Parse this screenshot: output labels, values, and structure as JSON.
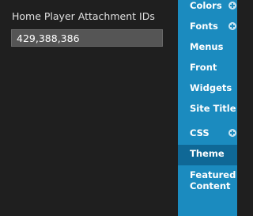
{
  "field": {
    "label": "Home Player Attachment IDs",
    "value": "429,388,386"
  },
  "menu": {
    "items": [
      {
        "label": "Colors",
        "expandable": true,
        "active": false
      },
      {
        "label": "Fonts",
        "expandable": true,
        "active": false
      },
      {
        "label": "Menus",
        "expandable": false,
        "active": false
      },
      {
        "label": "Front",
        "expandable": false,
        "active": false
      },
      {
        "label": "Widgets",
        "expandable": false,
        "active": false
      },
      {
        "label": "Site Title",
        "expandable": false,
        "active": false
      },
      {
        "label": "CSS",
        "expandable": true,
        "active": false
      },
      {
        "label": "Theme",
        "expandable": false,
        "active": true
      },
      {
        "label": "Featured Content",
        "expandable": false,
        "active": false
      }
    ],
    "expand_icon": "plus-circle-icon"
  },
  "colors": {
    "background": "#1f1f1f",
    "menu_background": "#1b8bbf",
    "menu_active": "#0f6896",
    "input_background": "#555555",
    "text": "#ffffff"
  }
}
